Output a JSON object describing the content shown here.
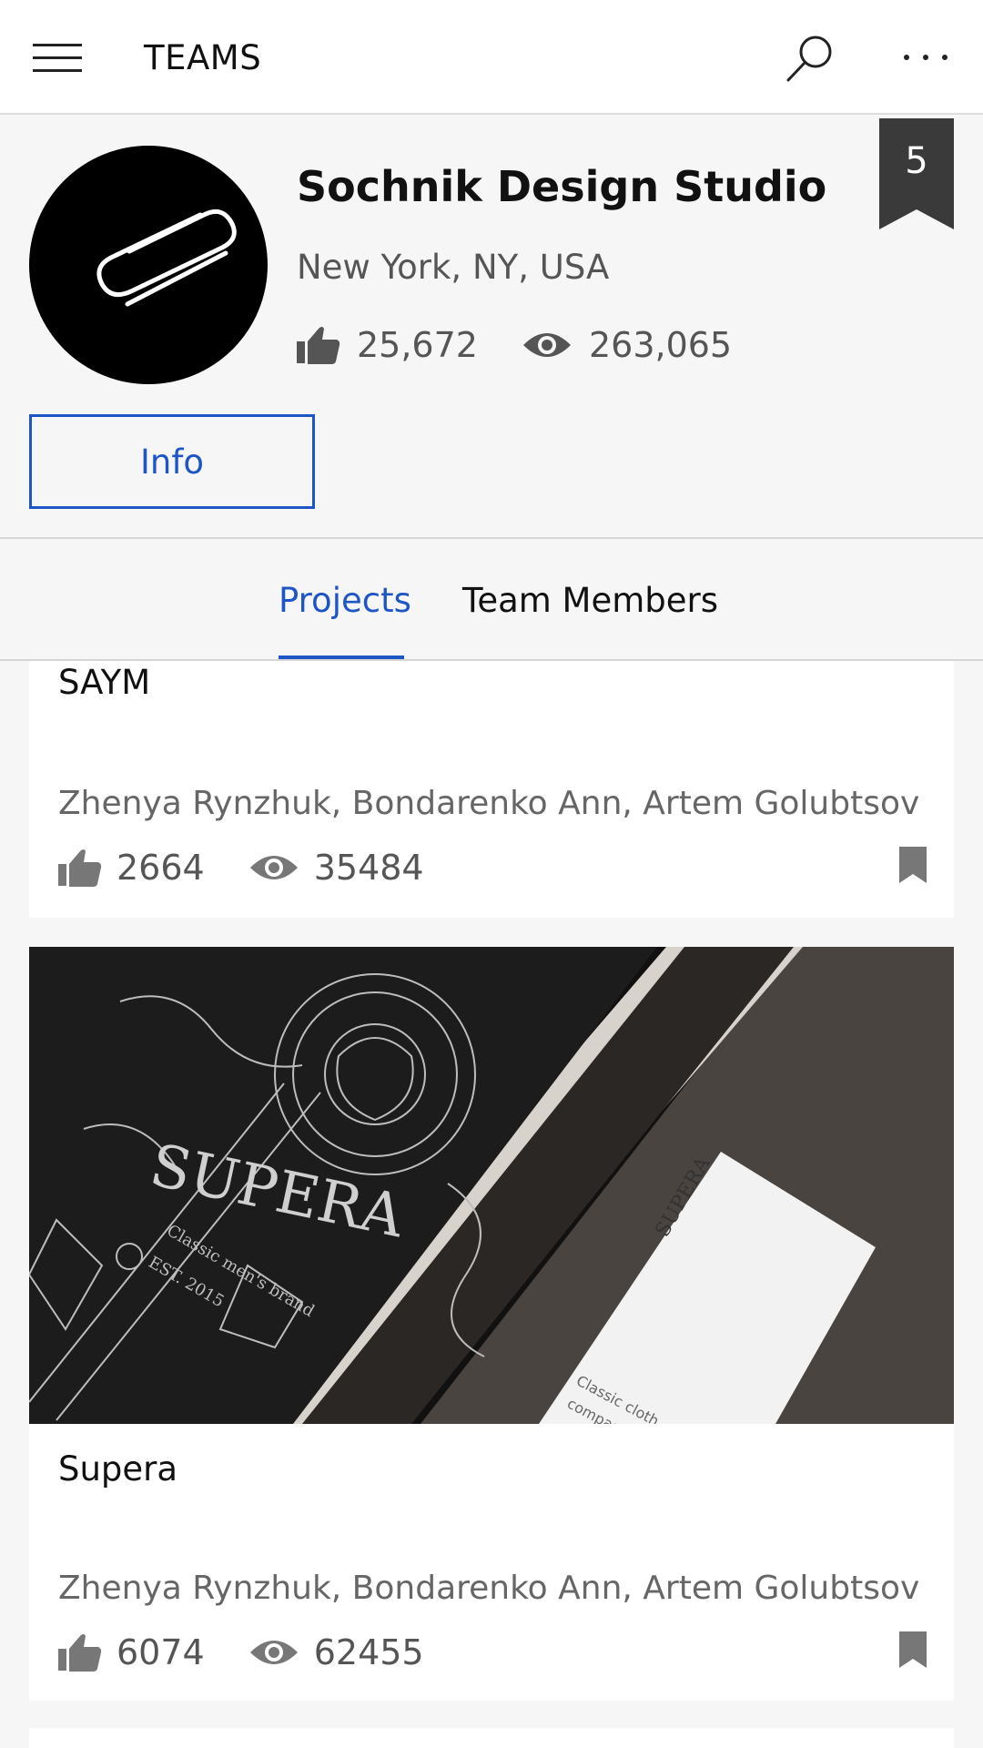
{
  "appbar": {
    "title": "TEAMS",
    "menu_icon": "hamburger-menu-icon",
    "search_icon": "search-icon",
    "more_icon": "more-dots-icon"
  },
  "team": {
    "name": "Sochnik Design Studio",
    "location": "New York, NY, USA",
    "likes": "25,672",
    "views": "263,065",
    "rank": "5",
    "info_button": "Info"
  },
  "tabs": [
    {
      "label": "Projects",
      "active": true
    },
    {
      "label": "Team Members",
      "active": false
    }
  ],
  "projects": [
    {
      "title": "SAYM",
      "authors": "Zhenya Rynzhuk, Bondarenko Ann, Artem Golubtsov",
      "likes": "2664",
      "views": "35484"
    },
    {
      "title": "Supera",
      "authors": "Zhenya Rynzhuk, Bondarenko Ann, Artem Golubtsov",
      "likes": "6074",
      "views": "62455",
      "image_text": {
        "brand": "SUPERA",
        "tagline": "Classic men's brand",
        "est": "EST. 2015",
        "card_brand": "SUPERA",
        "card_text": "Classic cloth",
        "card_text2": "company"
      }
    }
  ],
  "colors": {
    "accent": "#1e56c6",
    "badge": "#3a3a3a",
    "icon_gray": "#666666"
  }
}
